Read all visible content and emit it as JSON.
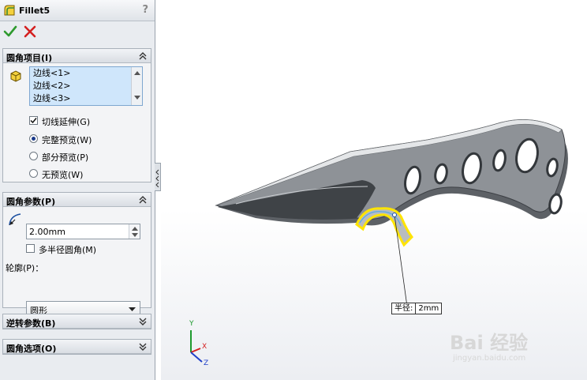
{
  "window": {
    "title": "Fillet5",
    "help": "?"
  },
  "actions": {
    "ok": "ok",
    "cancel": "cancel"
  },
  "fillet_items": {
    "header": "圆角项目(I)",
    "edges": [
      "边线<1>",
      "边线<2>",
      "边线<3>"
    ],
    "tangent_propagation": {
      "label": "切线延伸(G)",
      "checked": true
    },
    "preview_options": [
      {
        "label": "完整预览(W)",
        "selected": true
      },
      {
        "label": "部分预览(P)",
        "selected": false
      },
      {
        "label": "无预览(W)",
        "selected": false
      }
    ]
  },
  "fillet_params": {
    "header": "圆角参数(P)",
    "radius_value": "2.00mm",
    "multi_radius": {
      "label": "多半径圆角(M)",
      "checked": false
    },
    "profile_label": "轮廓(P)：",
    "profile_value": "圆形"
  },
  "setback_params": {
    "header": "逆转参数(B)"
  },
  "fillet_options": {
    "header": "圆角选项(O)"
  },
  "viewport": {
    "callout_label": "半径:",
    "callout_value": "2mm",
    "triad": {
      "x": "X",
      "y": "Y",
      "z": "Z"
    }
  },
  "watermark": {
    "brand": "Bai 经验",
    "url": "jingyan.baidu.com"
  },
  "colors": {
    "panel_bg": "#e9ecf0",
    "selection_bg": "#cfe6fb",
    "highlight_edge": "#ffe400",
    "part_body": "#8e9297",
    "ok_green": "#2e9a2e",
    "cancel_red": "#d42020"
  }
}
